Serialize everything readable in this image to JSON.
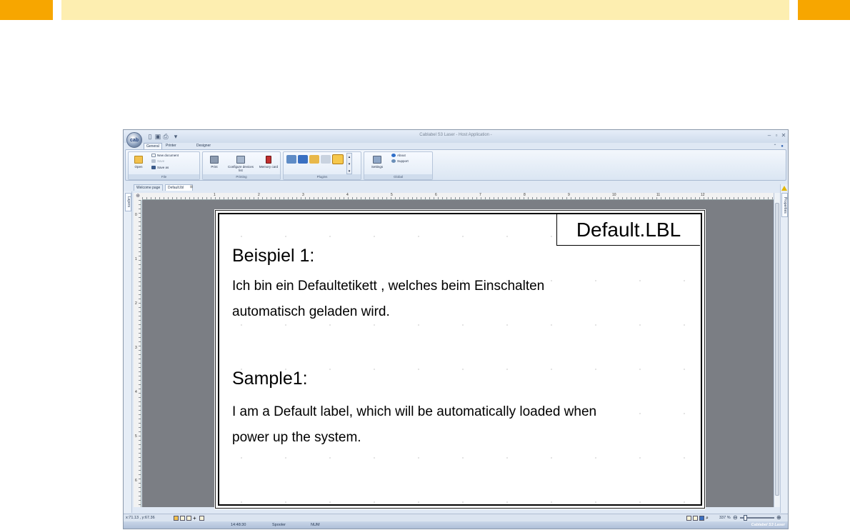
{
  "window": {
    "title": "Cablabel S3 Laser - Host Application -",
    "app_orb_text": "cab",
    "controls": [
      "–",
      "▫",
      "✕"
    ]
  },
  "ribbon_tabs": [
    "General",
    "Printer Spooler",
    "Designer"
  ],
  "ribbon": {
    "file": {
      "caption": "File",
      "open": "Open",
      "new_document": "New document",
      "save": "Save",
      "save_as": "Save as"
    },
    "printing": {
      "caption": "Printing",
      "print": "Print",
      "configure": "Configure devices list",
      "memory_card": "Memory card"
    },
    "plugins": {
      "caption": "Plugins"
    },
    "global": {
      "caption": "Global",
      "settings": "Settings",
      "about": "About",
      "support": "Support"
    }
  },
  "doc_tabs": [
    "Welcome page",
    "Default.lbl"
  ],
  "side_panels": {
    "layers": "Layers",
    "properties": "Properties"
  },
  "ruler": {
    "h_numbers": [
      "1",
      "2",
      "3",
      "4",
      "5",
      "6",
      "7",
      "8",
      "9",
      "10",
      "11",
      "12"
    ],
    "v_numbers": [
      "0",
      "1",
      "2",
      "3",
      "4",
      "5",
      "6",
      "7"
    ]
  },
  "label": {
    "name_box": "Default.LBL",
    "heading_de": "Beispiel 1:",
    "body_de_line1": "Ich bin ein Defaultetikett , welches beim Einschalten",
    "body_de_line2": "automatisch geladen wird.",
    "heading_en": "Sample1:",
    "body_en_line1": "I am a Default label, which will be automatically loaded when",
    "body_en_line2": "power up the system."
  },
  "status": {
    "coordinates": "x:71.13 , y:67.36",
    "time": "14:48:30",
    "spooler": "Spooler",
    "num": "NUM",
    "zoom": "337 %",
    "brand": "Cablabel S3 Laser"
  },
  "colors": {
    "accent_orange": "#f7a600",
    "header_cream": "#fdeeb0",
    "canvas_gray": "#7b7e84"
  }
}
